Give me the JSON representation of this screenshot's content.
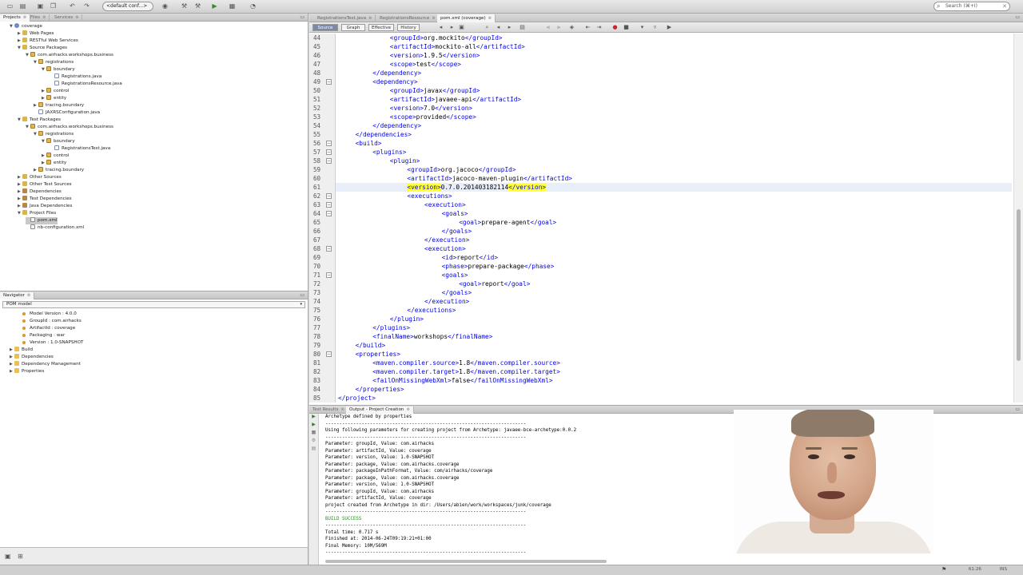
{
  "toolbar": {
    "config_select": "<default conf...>",
    "search_placeholder": "Search (⌘+I)",
    "icons": [
      "new-project-icon",
      "open-project-icon",
      "save-all-icon",
      "copy-icon",
      "undo-icon",
      "redo-icon",
      "config-select",
      "globe-icon",
      "build-icon",
      "clean-build-icon",
      "run-icon",
      "debug-icon",
      "profile-icon"
    ]
  },
  "left_top": {
    "tabs": [
      {
        "label": "Projects",
        "active": true
      },
      {
        "label": "Files",
        "active": false
      },
      {
        "label": "Services",
        "active": false
      }
    ],
    "tree": [
      {
        "indent": 0,
        "toggle": "▼",
        "icon": "proj",
        "label": "coverage"
      },
      {
        "indent": 1,
        "toggle": "▶",
        "icon": "folder",
        "label": "Web Pages"
      },
      {
        "indent": 1,
        "toggle": "▶",
        "icon": "folder",
        "label": "RESTful Web Services"
      },
      {
        "indent": 1,
        "toggle": "▼",
        "icon": "folder",
        "label": "Source Packages"
      },
      {
        "indent": 2,
        "toggle": "▼",
        "icon": "pkg",
        "label": "com.airhacks.workshops.business"
      },
      {
        "indent": 3,
        "toggle": "▼",
        "icon": "pkg",
        "label": "registrations"
      },
      {
        "indent": 4,
        "toggle": "▼",
        "icon": "pkg",
        "label": "boundary"
      },
      {
        "indent": 5,
        "toggle": "",
        "icon": "java",
        "label": "Registrations.java"
      },
      {
        "indent": 5,
        "toggle": "",
        "icon": "java",
        "label": "RegistrationsResource.java"
      },
      {
        "indent": 4,
        "toggle": "▶",
        "icon": "pkg",
        "label": "control"
      },
      {
        "indent": 4,
        "toggle": "▶",
        "icon": "pkg",
        "label": "entity"
      },
      {
        "indent": 3,
        "toggle": "▶",
        "icon": "pkg",
        "label": "tracing.boundary"
      },
      {
        "indent": 3,
        "toggle": "",
        "icon": "java",
        "label": "JAXRSConfiguration.java"
      },
      {
        "indent": 1,
        "toggle": "▼",
        "icon": "folder",
        "label": "Test Packages"
      },
      {
        "indent": 2,
        "toggle": "▼",
        "icon": "pkg",
        "label": "com.airhacks.workshops.business"
      },
      {
        "indent": 3,
        "toggle": "▼",
        "icon": "pkg",
        "label": "registrations"
      },
      {
        "indent": 4,
        "toggle": "▼",
        "icon": "pkg",
        "label": "boundary"
      },
      {
        "indent": 5,
        "toggle": "",
        "icon": "java",
        "label": "RegistrationsTest.java"
      },
      {
        "indent": 4,
        "toggle": "▶",
        "icon": "pkg",
        "label": "control"
      },
      {
        "indent": 4,
        "toggle": "▶",
        "icon": "pkg",
        "label": "entity"
      },
      {
        "indent": 3,
        "toggle": "▶",
        "icon": "pkg",
        "label": "tracing.boundary"
      },
      {
        "indent": 1,
        "toggle": "▶",
        "icon": "folder",
        "label": "Other Sources"
      },
      {
        "indent": 1,
        "toggle": "▶",
        "icon": "folder",
        "label": "Other Test Sources"
      },
      {
        "indent": 1,
        "toggle": "▶",
        "icon": "lib",
        "label": "Dependencies"
      },
      {
        "indent": 1,
        "toggle": "▶",
        "icon": "lib",
        "label": "Test Dependencies"
      },
      {
        "indent": 1,
        "toggle": "▶",
        "icon": "lib",
        "label": "Java Dependencies"
      },
      {
        "indent": 1,
        "toggle": "▼",
        "icon": "folder",
        "label": "Project Files"
      },
      {
        "indent": 2,
        "toggle": "",
        "icon": "xml",
        "label": "pom.xml",
        "selected": true
      },
      {
        "indent": 2,
        "toggle": "",
        "icon": "xml",
        "label": "nb-configuration.xml"
      }
    ]
  },
  "navigator": {
    "tab": "Navigator",
    "select": "POM model",
    "items": [
      {
        "indent": 1,
        "toggle": "",
        "icon": "dot",
        "label": "Model Version : 4.0.0"
      },
      {
        "indent": 1,
        "toggle": "",
        "icon": "dot",
        "label": "GroupId : com.airhacks"
      },
      {
        "indent": 1,
        "toggle": "",
        "icon": "dot",
        "label": "ArtifactId : coverage"
      },
      {
        "indent": 1,
        "toggle": "",
        "icon": "dot",
        "label": "Packaging : war"
      },
      {
        "indent": 1,
        "toggle": "",
        "icon": "dot",
        "label": "Version : 1.0-SNAPSHOT"
      },
      {
        "indent": 0,
        "toggle": "▶",
        "icon": "prop",
        "label": "Build"
      },
      {
        "indent": 0,
        "toggle": "▶",
        "icon": "prop",
        "label": "Dependencies"
      },
      {
        "indent": 0,
        "toggle": "▶",
        "icon": "prop",
        "label": "Dependency Management"
      },
      {
        "indent": 0,
        "toggle": "▶",
        "icon": "prop",
        "label": "Properties"
      }
    ]
  },
  "editor": {
    "tabs": [
      {
        "label": "RegistrationsTest.java",
        "active": false
      },
      {
        "label": "RegistrationsResource",
        "active": false
      },
      {
        "label": "pom.xml (coverage)",
        "active": true
      }
    ],
    "views": [
      {
        "label": "Source",
        "active": true
      },
      {
        "label": "Graph",
        "active": false
      },
      {
        "label": "Effective",
        "active": false
      },
      {
        "label": "History",
        "active": false
      }
    ],
    "current_line": 61,
    "lines": [
      {
        "n": 44,
        "fold": "",
        "ind": 6,
        "segs": [
          [
            "t",
            "<groupId>"
          ],
          [
            "x",
            "org.mockito"
          ],
          [
            "t",
            "</groupId>"
          ]
        ]
      },
      {
        "n": 45,
        "fold": "",
        "ind": 6,
        "segs": [
          [
            "t",
            "<artifactId>"
          ],
          [
            "x",
            "mockito-all"
          ],
          [
            "t",
            "</artifactId>"
          ]
        ]
      },
      {
        "n": 46,
        "fold": "",
        "ind": 6,
        "segs": [
          [
            "t",
            "<version>"
          ],
          [
            "x",
            "1.9.5"
          ],
          [
            "t",
            "</version>"
          ]
        ]
      },
      {
        "n": 47,
        "fold": "",
        "ind": 6,
        "segs": [
          [
            "t",
            "<scope>"
          ],
          [
            "x",
            "test"
          ],
          [
            "t",
            "</scope>"
          ]
        ]
      },
      {
        "n": 48,
        "fold": "",
        "ind": 4,
        "segs": [
          [
            "t",
            "</dependency>"
          ]
        ]
      },
      {
        "n": 49,
        "fold": "−",
        "ind": 4,
        "segs": [
          [
            "t",
            "<dependency>"
          ]
        ]
      },
      {
        "n": 50,
        "fold": "",
        "ind": 6,
        "segs": [
          [
            "t",
            "<groupId>"
          ],
          [
            "x",
            "javax"
          ],
          [
            "t",
            "</groupId>"
          ]
        ]
      },
      {
        "n": 51,
        "fold": "",
        "ind": 6,
        "segs": [
          [
            "t",
            "<artifactId>"
          ],
          [
            "x",
            "javaee-api"
          ],
          [
            "t",
            "</artifactId>"
          ]
        ]
      },
      {
        "n": 52,
        "fold": "",
        "ind": 6,
        "segs": [
          [
            "t",
            "<version>"
          ],
          [
            "x",
            "7.0"
          ],
          [
            "t",
            "</version>"
          ]
        ]
      },
      {
        "n": 53,
        "fold": "",
        "ind": 6,
        "segs": [
          [
            "t",
            "<scope>"
          ],
          [
            "x",
            "provided"
          ],
          [
            "t",
            "</scope>"
          ]
        ]
      },
      {
        "n": 54,
        "fold": "",
        "ind": 4,
        "segs": [
          [
            "t",
            "</dependency>"
          ]
        ]
      },
      {
        "n": 55,
        "fold": "",
        "ind": 2,
        "segs": [
          [
            "t",
            "</dependencies>"
          ]
        ]
      },
      {
        "n": 56,
        "fold": "−",
        "ind": 2,
        "segs": [
          [
            "t",
            "<build>"
          ]
        ]
      },
      {
        "n": 57,
        "fold": "−",
        "ind": 4,
        "segs": [
          [
            "t",
            "<plugins>"
          ]
        ]
      },
      {
        "n": 58,
        "fold": "−",
        "ind": 6,
        "segs": [
          [
            "t",
            "<plugin>"
          ]
        ]
      },
      {
        "n": 59,
        "fold": "",
        "ind": 8,
        "segs": [
          [
            "t",
            "<groupId>"
          ],
          [
            "x",
            "org.jacoco"
          ],
          [
            "t",
            "</groupId>"
          ]
        ]
      },
      {
        "n": 60,
        "fold": "",
        "ind": 8,
        "segs": [
          [
            "t",
            "<artifactId>"
          ],
          [
            "x",
            "jacoco-maven-plugin"
          ],
          [
            "t",
            "</artifactId>"
          ]
        ]
      },
      {
        "n": 61,
        "fold": "",
        "ind": 8,
        "segs": [
          [
            "h",
            "<version>"
          ],
          [
            "x",
            "0.7.0.201403182114"
          ],
          [
            "h",
            "</version>"
          ]
        ]
      },
      {
        "n": 62,
        "fold": "−",
        "ind": 8,
        "segs": [
          [
            "t",
            "<executions>"
          ]
        ]
      },
      {
        "n": 63,
        "fold": "−",
        "ind": 10,
        "segs": [
          [
            "t",
            "<execution>"
          ]
        ]
      },
      {
        "n": 64,
        "fold": "−",
        "ind": 12,
        "segs": [
          [
            "t",
            "<goals>"
          ]
        ]
      },
      {
        "n": 65,
        "fold": "",
        "ind": 14,
        "segs": [
          [
            "t",
            "<goal>"
          ],
          [
            "x",
            "prepare-agent"
          ],
          [
            "t",
            "</goal>"
          ]
        ]
      },
      {
        "n": 66,
        "fold": "",
        "ind": 12,
        "segs": [
          [
            "t",
            "</goals>"
          ]
        ]
      },
      {
        "n": 67,
        "fold": "",
        "ind": 10,
        "segs": [
          [
            "t",
            "</execution>"
          ]
        ]
      },
      {
        "n": 68,
        "fold": "−",
        "ind": 10,
        "segs": [
          [
            "t",
            "<execution>"
          ]
        ]
      },
      {
        "n": 69,
        "fold": "",
        "ind": 12,
        "segs": [
          [
            "t",
            "<id>"
          ],
          [
            "x",
            "report"
          ],
          [
            "t",
            "</id>"
          ]
        ]
      },
      {
        "n": 70,
        "fold": "",
        "ind": 12,
        "segs": [
          [
            "t",
            "<phase>"
          ],
          [
            "x",
            "prepare-package"
          ],
          [
            "t",
            "</phase>"
          ]
        ]
      },
      {
        "n": 71,
        "fold": "−",
        "ind": 12,
        "segs": [
          [
            "t",
            "<goals>"
          ]
        ]
      },
      {
        "n": 72,
        "fold": "",
        "ind": 14,
        "segs": [
          [
            "t",
            "<goal>"
          ],
          [
            "x",
            "report"
          ],
          [
            "t",
            "</goal>"
          ]
        ]
      },
      {
        "n": 73,
        "fold": "",
        "ind": 12,
        "segs": [
          [
            "t",
            "</goals>"
          ]
        ]
      },
      {
        "n": 74,
        "fold": "",
        "ind": 10,
        "segs": [
          [
            "t",
            "</execution>"
          ]
        ]
      },
      {
        "n": 75,
        "fold": "",
        "ind": 8,
        "segs": [
          [
            "t",
            "</executions>"
          ]
        ]
      },
      {
        "n": 76,
        "fold": "",
        "ind": 6,
        "segs": [
          [
            "t",
            "</plugin>"
          ]
        ]
      },
      {
        "n": 77,
        "fold": "",
        "ind": 4,
        "segs": [
          [
            "t",
            "</plugins>"
          ]
        ]
      },
      {
        "n": 78,
        "fold": "",
        "ind": 4,
        "segs": [
          [
            "t",
            "<finalName>"
          ],
          [
            "x",
            "workshops"
          ],
          [
            "t",
            "</finalName>"
          ]
        ]
      },
      {
        "n": 79,
        "fold": "",
        "ind": 2,
        "segs": [
          [
            "t",
            "</build>"
          ]
        ]
      },
      {
        "n": 80,
        "fold": "−",
        "ind": 2,
        "segs": [
          [
            "t",
            "<properties>"
          ]
        ]
      },
      {
        "n": 81,
        "fold": "",
        "ind": 4,
        "segs": [
          [
            "t",
            "<maven.compiler.source>"
          ],
          [
            "x",
            "1.8"
          ],
          [
            "t",
            "</maven.compiler.source>"
          ]
        ]
      },
      {
        "n": 82,
        "fold": "",
        "ind": 4,
        "segs": [
          [
            "t",
            "<maven.compiler.target>"
          ],
          [
            "x",
            "1.8"
          ],
          [
            "t",
            "</maven.compiler.target>"
          ]
        ]
      },
      {
        "n": 83,
        "fold": "",
        "ind": 4,
        "segs": [
          [
            "t",
            "<failOnMissingWebXml>"
          ],
          [
            "x",
            "false"
          ],
          [
            "t",
            "</failOnMissingWebXml>"
          ]
        ]
      },
      {
        "n": 84,
        "fold": "",
        "ind": 2,
        "segs": [
          [
            "t",
            "</properties>"
          ]
        ]
      },
      {
        "n": 85,
        "fold": "",
        "ind": 0,
        "segs": [
          [
            "t",
            "</project>"
          ]
        ]
      }
    ]
  },
  "output": {
    "tabs": [
      {
        "label": "Test Results",
        "active": false
      },
      {
        "label": "Output - Project Creation",
        "active": true
      }
    ],
    "lines": [
      {
        "text": "Archetype defined by properties",
        "green": false
      },
      {
        "text": "------------------------------------------------------------------------",
        "green": false
      },
      {
        "text": "Using following parameters for creating project from Archetype: javaee-bce-archetype:0.0.2",
        "green": false
      },
      {
        "text": "------------------------------------------------------------------------",
        "green": false
      },
      {
        "text": "Parameter: groupId, Value: com.airhacks",
        "green": false
      },
      {
        "text": "Parameter: artifactId, Value: coverage",
        "green": false
      },
      {
        "text": "Parameter: version, Value: 1.0-SNAPSHOT",
        "green": false
      },
      {
        "text": "Parameter: package, Value: com.airhacks.coverage",
        "green": false
      },
      {
        "text": "Parameter: packageInPathFormat, Value: com/airhacks/coverage",
        "green": false
      },
      {
        "text": "Parameter: package, Value: com.airhacks.coverage",
        "green": false
      },
      {
        "text": "Parameter: version, Value: 1.0-SNAPSHOT",
        "green": false
      },
      {
        "text": "Parameter: groupId, Value: com.airhacks",
        "green": false
      },
      {
        "text": "Parameter: artifactId, Value: coverage",
        "green": false
      },
      {
        "text": "project created from Archetype in dir: /Users/abien/work/workspaces/junk/coverage",
        "green": false
      },
      {
        "text": "------------------------------------------------------------------------",
        "green": false
      },
      {
        "text": "BUILD SUCCESS",
        "green": true
      },
      {
        "text": "------------------------------------------------------------------------",
        "green": false
      },
      {
        "text": "Total time: 0.717 s",
        "green": false
      },
      {
        "text": "Finished at: 2014-06-24T09:19:21+01:00",
        "green": false
      },
      {
        "text": "Final Memory: 10M/569M",
        "green": false
      },
      {
        "text": "------------------------------------------------------------------------",
        "green": false
      }
    ]
  },
  "statusbar": {
    "position": "61:26",
    "mode": "INS"
  }
}
